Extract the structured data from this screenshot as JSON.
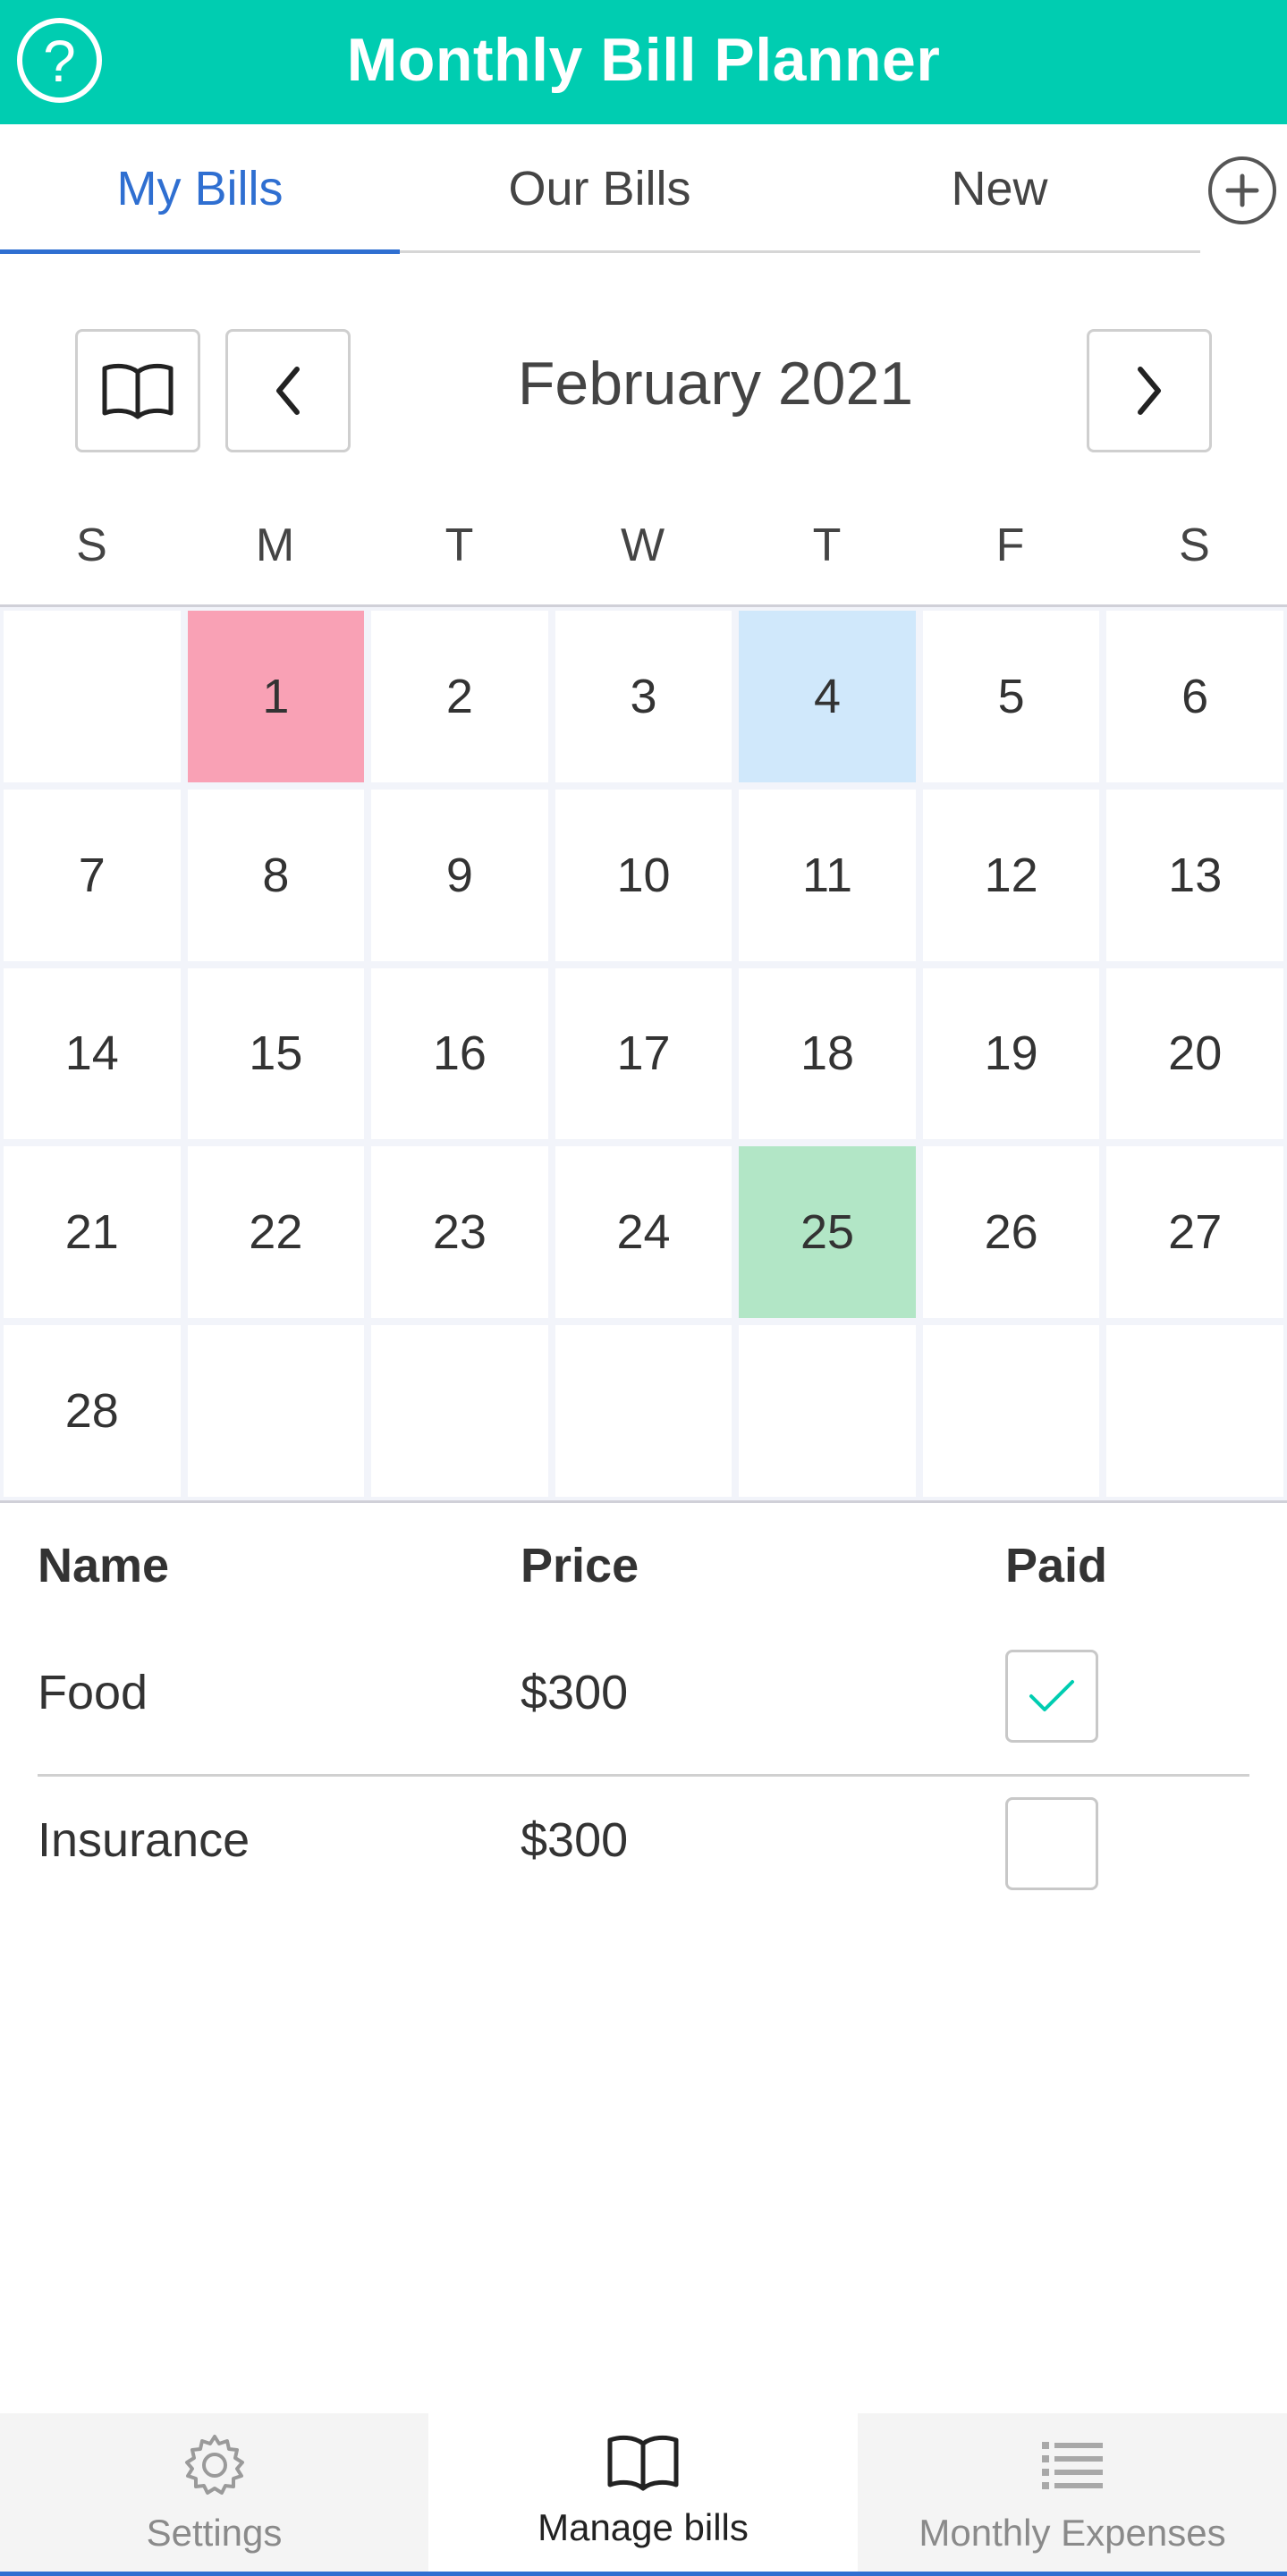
{
  "header": {
    "title": "Monthly Bill Planner",
    "help_icon": "?"
  },
  "tabs": [
    {
      "label": "My Bills",
      "active": true
    },
    {
      "label": "Our Bills",
      "active": false
    },
    {
      "label": "New",
      "active": false
    }
  ],
  "calendar": {
    "month_label": "February 2021",
    "day_names": [
      "S",
      "M",
      "T",
      "W",
      "T",
      "F",
      "S"
    ],
    "days": [
      "",
      "1",
      "2",
      "3",
      "4",
      "5",
      "6",
      "7",
      "8",
      "9",
      "10",
      "11",
      "12",
      "13",
      "14",
      "15",
      "16",
      "17",
      "18",
      "19",
      "20",
      "21",
      "22",
      "23",
      "24",
      "25",
      "26",
      "27",
      "28",
      "",
      "",
      "",
      "",
      "",
      ""
    ],
    "highlights": {
      "1": "#F9A1B5",
      "4": "#D0E8FB",
      "25": "#B2E6C6"
    }
  },
  "bills": {
    "headers": {
      "name": "Name",
      "price": "Price",
      "paid": "Paid"
    },
    "rows": [
      {
        "name": "Food",
        "price": "$300",
        "paid": true
      },
      {
        "name": "Insurance",
        "price": "$300",
        "paid": false
      }
    ]
  },
  "bottom_nav": [
    {
      "label": "Settings",
      "icon": "gear-icon",
      "active": false
    },
    {
      "label": "Manage bills",
      "icon": "book-icon",
      "active": true
    },
    {
      "label": "Monthly Expenses",
      "icon": "list-icon",
      "active": false
    }
  ],
  "colors": {
    "header": "#00CDB1",
    "accent": "#2F6FD1",
    "check": "#00CDB1"
  }
}
